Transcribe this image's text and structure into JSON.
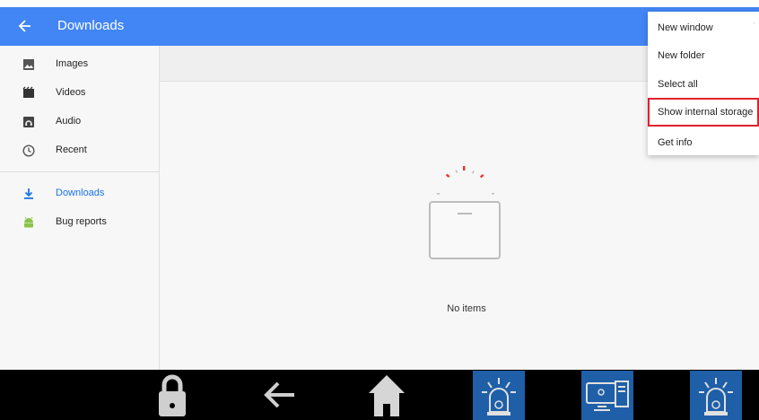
{
  "appbar": {
    "title": "Downloads",
    "color": "#4285f4",
    "back_icon": "arrow-left-icon"
  },
  "sidebar": {
    "items": [
      {
        "label": "Images",
        "icon": "image-icon",
        "active": false
      },
      {
        "label": "Videos",
        "icon": "video-icon",
        "active": false
      },
      {
        "label": "Audio",
        "icon": "audio-icon",
        "active": false
      },
      {
        "label": "Recent",
        "icon": "clock-icon",
        "active": false
      },
      {
        "label": "Downloads",
        "icon": "download-icon",
        "active": true
      },
      {
        "label": "Bug reports",
        "icon": "android-icon",
        "active": false
      }
    ],
    "active_color": "#1a73e8"
  },
  "main": {
    "empty_text": "No items"
  },
  "menu": {
    "items": [
      {
        "label": "New window",
        "highlighted": false
      },
      {
        "label": "New folder",
        "highlighted": false
      },
      {
        "label": "Select all",
        "highlighted": false
      },
      {
        "label": "Show internal storage",
        "highlighted": true
      },
      {
        "label": "Get info",
        "highlighted": false
      }
    ],
    "highlight_color": "#e0202e"
  },
  "navbar": {
    "buttons": [
      "lock-icon",
      "back-arrow-icon",
      "home-icon",
      "alarm-icon",
      "computer-icon",
      "alarm-icon"
    ],
    "tile_color": "#1e5fa8"
  }
}
